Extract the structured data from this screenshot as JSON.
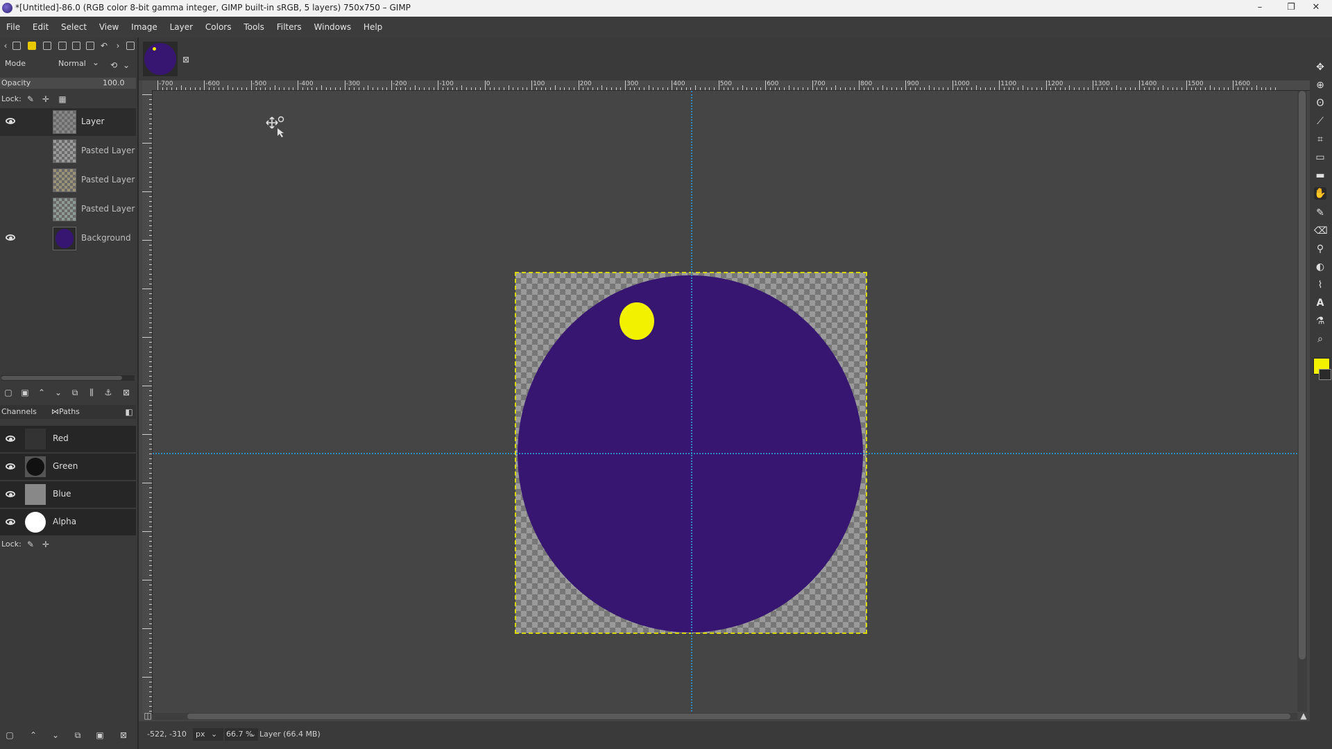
{
  "window": {
    "title": "*[Untitled]-86.0 (RGB color 8-bit gamma integer, GIMP built-in sRGB, 5 layers) 750x750 – GIMP",
    "controls": [
      "–",
      "❐",
      "✕"
    ]
  },
  "menubar": [
    "File",
    "Edit",
    "Select",
    "View",
    "Image",
    "Layer",
    "Colors",
    "Tools",
    "Filters",
    "Windows",
    "Help"
  ],
  "layers_panel": {
    "mode_label": "Mode",
    "mode_value": "Normal",
    "opacity_label": "Opacity",
    "opacity_value": "100.0",
    "lock_label": "Lock:",
    "layers": [
      {
        "name": "Layer",
        "visible": true,
        "active": true
      },
      {
        "name": "Pasted Layer",
        "visible": false,
        "active": false
      },
      {
        "name": "Pasted Layer",
        "visible": false,
        "active": false
      },
      {
        "name": "Pasted Layer",
        "visible": false,
        "active": false
      },
      {
        "name": "Background",
        "visible": true,
        "active": false
      }
    ]
  },
  "channels_panel": {
    "tab_channels": "Channels",
    "tab_paths": "Paths",
    "channels": [
      {
        "name": "Red"
      },
      {
        "name": "Green"
      },
      {
        "name": "Blue"
      },
      {
        "name": "Alpha"
      }
    ],
    "lock_label": "Lock:"
  },
  "ruler": {
    "ticks": [
      "-700",
      "-600",
      "-500",
      "-400",
      "-300",
      "-200",
      "-100",
      "0",
      "100",
      "200",
      "300",
      "400",
      "500",
      "600",
      "700",
      "800",
      "900",
      "1000",
      "1100",
      "1200",
      "1300",
      "1400",
      "1500",
      "1600"
    ]
  },
  "statusbar": {
    "coords": "-522, -310",
    "unit": "px",
    "zoom": "66.7 %",
    "layer_info": "Layer (66.4 MB)"
  },
  "colors": {
    "foreground": "#f2f200",
    "circle": "#371672",
    "guide": "#2b8cc4"
  },
  "icons": {
    "toolbox": [
      "move-icon",
      "zoom-icon",
      "lasso-icon",
      "fuzzy-select-icon",
      "crop-icon",
      "transform-icon",
      "bucket-fill-icon",
      "smudge-icon",
      "paintbrush-icon",
      "eraser-icon",
      "clone-icon",
      "dodge-icon",
      "path-icon",
      "text-icon",
      "color-picker-icon",
      "magnify-icon"
    ]
  }
}
